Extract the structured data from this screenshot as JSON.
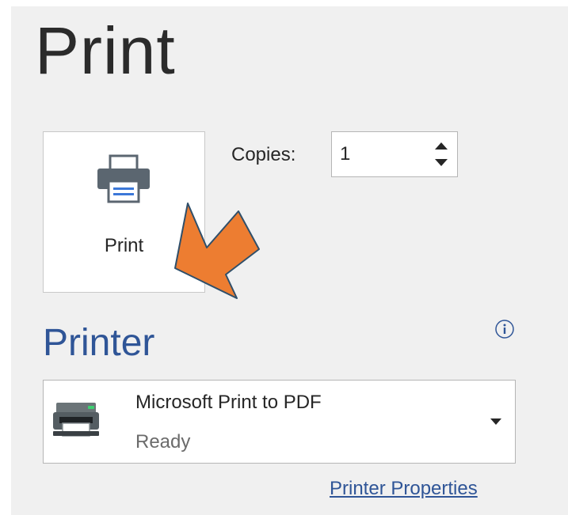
{
  "page": {
    "title": "Print"
  },
  "print_button": {
    "label": "Print",
    "icon": "printer-icon"
  },
  "copies": {
    "label": "Copies:",
    "value": "1",
    "icons": {
      "up": "chevron-up-icon",
      "down": "chevron-down-icon"
    }
  },
  "annotation": {
    "icon": "orange-arrow-icon",
    "color": "#ed7d31"
  },
  "printer": {
    "section_title": "Printer",
    "info_icon": "info-icon",
    "selected": {
      "name": "Microsoft Print to PDF",
      "status": "Ready",
      "icon": "printer-device-icon"
    },
    "properties_link": "Printer Properties"
  },
  "colors": {
    "accent": "#2f5597",
    "panel_bg": "#f0f0f0"
  }
}
